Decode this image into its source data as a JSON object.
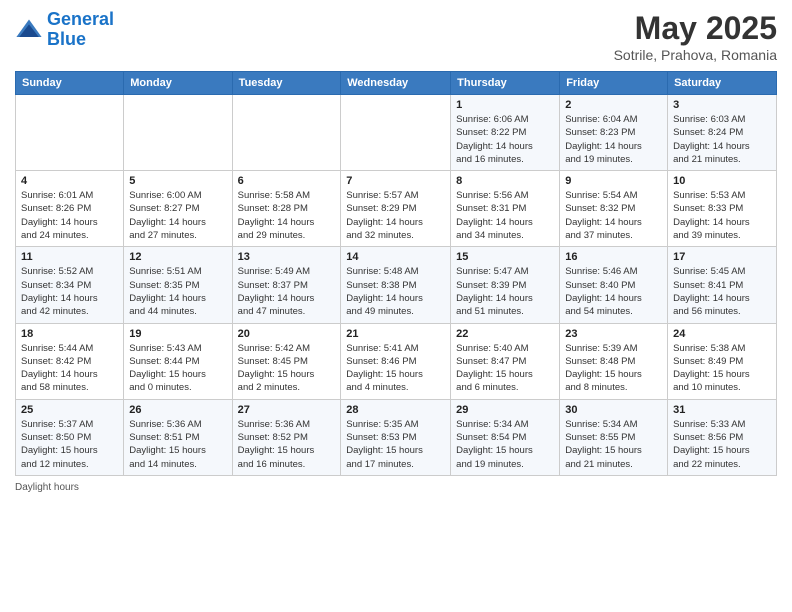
{
  "header": {
    "logo_line1": "General",
    "logo_line2": "Blue",
    "month": "May 2025",
    "location": "Sotrile, Prahova, Romania"
  },
  "days_of_week": [
    "Sunday",
    "Monday",
    "Tuesday",
    "Wednesday",
    "Thursday",
    "Friday",
    "Saturday"
  ],
  "weeks": [
    [
      {
        "day": "",
        "info": ""
      },
      {
        "day": "",
        "info": ""
      },
      {
        "day": "",
        "info": ""
      },
      {
        "day": "",
        "info": ""
      },
      {
        "day": "1",
        "info": "Sunrise: 6:06 AM\nSunset: 8:22 PM\nDaylight: 14 hours\nand 16 minutes."
      },
      {
        "day": "2",
        "info": "Sunrise: 6:04 AM\nSunset: 8:23 PM\nDaylight: 14 hours\nand 19 minutes."
      },
      {
        "day": "3",
        "info": "Sunrise: 6:03 AM\nSunset: 8:24 PM\nDaylight: 14 hours\nand 21 minutes."
      }
    ],
    [
      {
        "day": "4",
        "info": "Sunrise: 6:01 AM\nSunset: 8:26 PM\nDaylight: 14 hours\nand 24 minutes."
      },
      {
        "day": "5",
        "info": "Sunrise: 6:00 AM\nSunset: 8:27 PM\nDaylight: 14 hours\nand 27 minutes."
      },
      {
        "day": "6",
        "info": "Sunrise: 5:58 AM\nSunset: 8:28 PM\nDaylight: 14 hours\nand 29 minutes."
      },
      {
        "day": "7",
        "info": "Sunrise: 5:57 AM\nSunset: 8:29 PM\nDaylight: 14 hours\nand 32 minutes."
      },
      {
        "day": "8",
        "info": "Sunrise: 5:56 AM\nSunset: 8:31 PM\nDaylight: 14 hours\nand 34 minutes."
      },
      {
        "day": "9",
        "info": "Sunrise: 5:54 AM\nSunset: 8:32 PM\nDaylight: 14 hours\nand 37 minutes."
      },
      {
        "day": "10",
        "info": "Sunrise: 5:53 AM\nSunset: 8:33 PM\nDaylight: 14 hours\nand 39 minutes."
      }
    ],
    [
      {
        "day": "11",
        "info": "Sunrise: 5:52 AM\nSunset: 8:34 PM\nDaylight: 14 hours\nand 42 minutes."
      },
      {
        "day": "12",
        "info": "Sunrise: 5:51 AM\nSunset: 8:35 PM\nDaylight: 14 hours\nand 44 minutes."
      },
      {
        "day": "13",
        "info": "Sunrise: 5:49 AM\nSunset: 8:37 PM\nDaylight: 14 hours\nand 47 minutes."
      },
      {
        "day": "14",
        "info": "Sunrise: 5:48 AM\nSunset: 8:38 PM\nDaylight: 14 hours\nand 49 minutes."
      },
      {
        "day": "15",
        "info": "Sunrise: 5:47 AM\nSunset: 8:39 PM\nDaylight: 14 hours\nand 51 minutes."
      },
      {
        "day": "16",
        "info": "Sunrise: 5:46 AM\nSunset: 8:40 PM\nDaylight: 14 hours\nand 54 minutes."
      },
      {
        "day": "17",
        "info": "Sunrise: 5:45 AM\nSunset: 8:41 PM\nDaylight: 14 hours\nand 56 minutes."
      }
    ],
    [
      {
        "day": "18",
        "info": "Sunrise: 5:44 AM\nSunset: 8:42 PM\nDaylight: 14 hours\nand 58 minutes."
      },
      {
        "day": "19",
        "info": "Sunrise: 5:43 AM\nSunset: 8:44 PM\nDaylight: 15 hours\nand 0 minutes."
      },
      {
        "day": "20",
        "info": "Sunrise: 5:42 AM\nSunset: 8:45 PM\nDaylight: 15 hours\nand 2 minutes."
      },
      {
        "day": "21",
        "info": "Sunrise: 5:41 AM\nSunset: 8:46 PM\nDaylight: 15 hours\nand 4 minutes."
      },
      {
        "day": "22",
        "info": "Sunrise: 5:40 AM\nSunset: 8:47 PM\nDaylight: 15 hours\nand 6 minutes."
      },
      {
        "day": "23",
        "info": "Sunrise: 5:39 AM\nSunset: 8:48 PM\nDaylight: 15 hours\nand 8 minutes."
      },
      {
        "day": "24",
        "info": "Sunrise: 5:38 AM\nSunset: 8:49 PM\nDaylight: 15 hours\nand 10 minutes."
      }
    ],
    [
      {
        "day": "25",
        "info": "Sunrise: 5:37 AM\nSunset: 8:50 PM\nDaylight: 15 hours\nand 12 minutes."
      },
      {
        "day": "26",
        "info": "Sunrise: 5:36 AM\nSunset: 8:51 PM\nDaylight: 15 hours\nand 14 minutes."
      },
      {
        "day": "27",
        "info": "Sunrise: 5:36 AM\nSunset: 8:52 PM\nDaylight: 15 hours\nand 16 minutes."
      },
      {
        "day": "28",
        "info": "Sunrise: 5:35 AM\nSunset: 8:53 PM\nDaylight: 15 hours\nand 17 minutes."
      },
      {
        "day": "29",
        "info": "Sunrise: 5:34 AM\nSunset: 8:54 PM\nDaylight: 15 hours\nand 19 minutes."
      },
      {
        "day": "30",
        "info": "Sunrise: 5:34 AM\nSunset: 8:55 PM\nDaylight: 15 hours\nand 21 minutes."
      },
      {
        "day": "31",
        "info": "Sunrise: 5:33 AM\nSunset: 8:56 PM\nDaylight: 15 hours\nand 22 minutes."
      }
    ]
  ],
  "footer": {
    "daylight_label": "Daylight hours"
  }
}
